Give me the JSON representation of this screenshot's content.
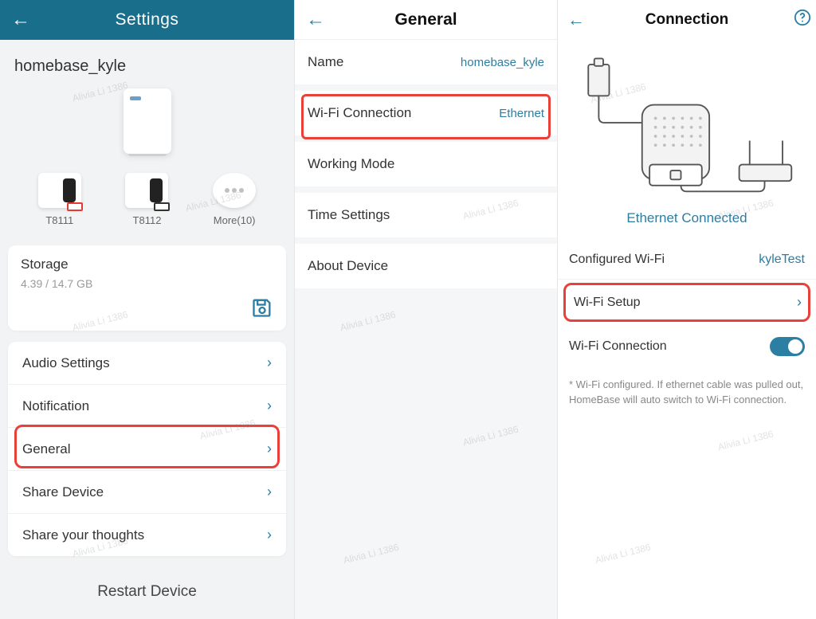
{
  "watermark": "Alivia Li 1386",
  "pane1": {
    "title": "Settings",
    "device_name": "homebase_kyle",
    "devices": [
      {
        "label": "T8111"
      },
      {
        "label": "T8112"
      }
    ],
    "more_label": "More(10)",
    "storage": {
      "title": "Storage",
      "value": "4.39 / 14.7 GB"
    },
    "menu": [
      {
        "label": "Audio Settings"
      },
      {
        "label": "Notification"
      },
      {
        "label": "General"
      },
      {
        "label": "Share Device"
      },
      {
        "label": "Share your thoughts"
      }
    ],
    "restart": "Restart Device"
  },
  "pane2": {
    "title": "General",
    "rows": [
      {
        "label": "Name",
        "value": "homebase_kyle"
      },
      {
        "label": "Wi-Fi Connection",
        "value": "Ethernet"
      },
      {
        "label": "Working Mode",
        "value": ""
      },
      {
        "label": "Time Settings",
        "value": ""
      },
      {
        "label": "About Device",
        "value": ""
      }
    ]
  },
  "pane3": {
    "title": "Connection",
    "status": "Ethernet Connected",
    "rows": {
      "configured_label": "Configured Wi-Fi",
      "configured_value": "kyleTest",
      "wifi_setup": "Wi-Fi Setup",
      "wifi_conn": "Wi-Fi Connection"
    },
    "note": "* Wi-Fi configured. If ethernet cable was pulled out, HomeBase will auto switch to Wi-Fi connection."
  }
}
